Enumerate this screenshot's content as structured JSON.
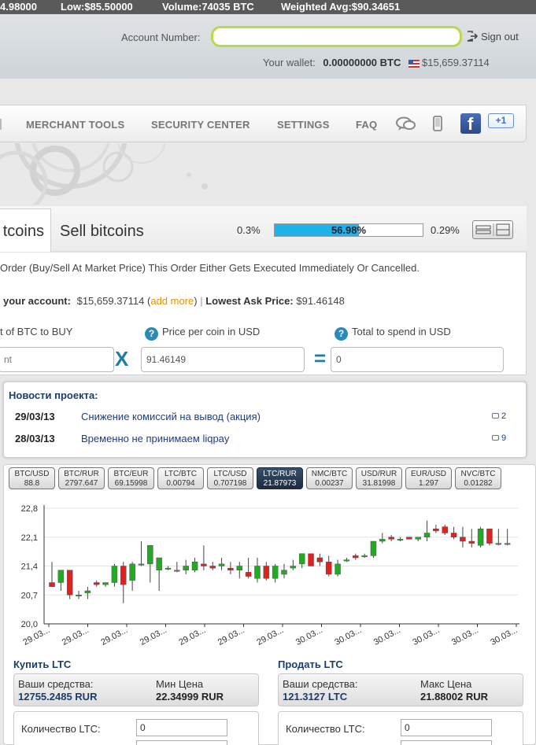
{
  "ticker": {
    "last": "4.98000",
    "low": "Low:$85.50000",
    "volume": "Volume:74035 BTC",
    "weighted": "Weighted Avg:$90.34651"
  },
  "header": {
    "account_label": "Account Number:",
    "account_value": "",
    "sign_out": "Sign out",
    "wallet_label": "Your wallet:",
    "wallet_btc": "0.00000000 BTC",
    "wallet_usd": "$15,659.37114"
  },
  "nav": {
    "items": [
      {
        "label": "MERCHANT TOOLS"
      },
      {
        "label": "SECURITY CENTER"
      },
      {
        "label": "SETTINGS"
      },
      {
        "label": "FAQ"
      }
    ],
    "gplus_label": "+1"
  },
  "trade": {
    "tab_buy": "tcoins",
    "tab_sell": "Sell bitcoins",
    "fee_left": "0.3%",
    "fee_right": "0.29%",
    "progress_text": "56.98%",
    "progress_value": 0.5698,
    "order_desc": "Order (Buy/Sell At Market Price) This Order Either Gets Executed Immediately Or Cancelled.",
    "acct_label": "your account:",
    "acct_value": "$15,659.37114",
    "add_more": "add more",
    "lowest_ask_label": "Lowest Ask Price:",
    "lowest_ask_value": "$91.46148",
    "label_amount": "t of BTC to BUY",
    "label_price": "Price per coin in USD",
    "label_total": "Total to spend in USD",
    "amount_placeholder": "nt",
    "price_value": "91.46149",
    "total_value": "0",
    "op_times": "X",
    "op_equals": "="
  },
  "news": {
    "title": "Новости проекта:",
    "items": [
      {
        "date": "29/03/13",
        "text": "Снижение комиссий на вывод (акция)",
        "count": "2"
      },
      {
        "date": "28/03/13",
        "text": "Временно не принимаем liqpay",
        "count": "9"
      }
    ]
  },
  "pairs": [
    {
      "name": "BTC/USD",
      "price": "88.8"
    },
    {
      "name": "BTC/RUR",
      "price": "2797.647"
    },
    {
      "name": "BTC/EUR",
      "price": "69.15998"
    },
    {
      "name": "LTC/BTC",
      "price": "0.00794"
    },
    {
      "name": "LTC/USD",
      "price": "0.707198"
    },
    {
      "name": "LTC/RUR",
      "price": "21.87973",
      "active": true
    },
    {
      "name": "NMC/BTC",
      "price": "0.00237"
    },
    {
      "name": "USD/RUR",
      "price": "31.81998"
    },
    {
      "name": "EUR/USD",
      "price": "1.297"
    },
    {
      "name": "NVC/BTC",
      "price": "0.01282"
    }
  ],
  "chart_data": {
    "type": "candlestick",
    "yticks": [
      "22,8",
      "22,1",
      "21,4",
      "20,7",
      "20,0"
    ],
    "ylim": [
      20.0,
      22.8
    ],
    "xticks": [
      "29.03...",
      "29.03...",
      "29.03...",
      "29.03...",
      "29.03...",
      "29.03...",
      "29.03...",
      "30.03...",
      "30.03...",
      "30.03...",
      "30.03...",
      "30.03...",
      "30.03..."
    ],
    "colors": {
      "up": "#22aa22",
      "down": "#dd2222"
    },
    "candles": [
      {
        "o": 21.0,
        "h": 21.5,
        "l": 20.9,
        "c": 20.9
      },
      {
        "o": 21.0,
        "h": 21.3,
        "l": 20.8,
        "c": 21.3
      },
      {
        "o": 21.3,
        "h": 21.3,
        "l": 20.6,
        "c": 20.7
      },
      {
        "o": 20.7,
        "h": 20.8,
        "l": 20.6,
        "c": 20.7
      },
      {
        "o": 20.75,
        "h": 20.9,
        "l": 20.6,
        "c": 20.8
      },
      {
        "o": 21.0,
        "h": 21.05,
        "l": 20.9,
        "c": 20.95
      },
      {
        "o": 20.95,
        "h": 21.0,
        "l": 20.9,
        "c": 21.0
      },
      {
        "o": 21.0,
        "h": 21.45,
        "l": 20.9,
        "c": 21.4
      },
      {
        "o": 21.4,
        "h": 21.5,
        "l": 20.5,
        "c": 20.95
      },
      {
        "o": 21.05,
        "h": 21.5,
        "l": 20.8,
        "c": 21.45
      },
      {
        "o": 21.45,
        "h": 22.0,
        "l": 21.4,
        "c": 21.45
      },
      {
        "o": 21.45,
        "h": 21.9,
        "l": 21.0,
        "c": 21.9
      },
      {
        "o": 21.3,
        "h": 21.6,
        "l": 20.8,
        "c": 21.6
      },
      {
        "o": 21.35,
        "h": 21.4,
        "l": 21.3,
        "c": 21.35
      },
      {
        "o": 21.3,
        "h": 21.5,
        "l": 21.25,
        "c": 21.3
      },
      {
        "o": 21.3,
        "h": 21.55,
        "l": 21.2,
        "c": 21.4
      },
      {
        "o": 21.3,
        "h": 21.6,
        "l": 21.25,
        "c": 21.5
      },
      {
        "o": 21.45,
        "h": 21.9,
        "l": 21.3,
        "c": 21.4
      },
      {
        "o": 21.4,
        "h": 21.5,
        "l": 21.3,
        "c": 21.35
      },
      {
        "o": 21.4,
        "h": 21.6,
        "l": 21.3,
        "c": 21.45
      },
      {
        "o": 21.35,
        "h": 21.5,
        "l": 21.2,
        "c": 21.3
      },
      {
        "o": 21.3,
        "h": 21.5,
        "l": 21.1,
        "c": 21.4
      },
      {
        "o": 21.25,
        "h": 21.6,
        "l": 21.1,
        "c": 21.15
      },
      {
        "o": 21.1,
        "h": 21.6,
        "l": 21.0,
        "c": 21.4
      },
      {
        "o": 21.4,
        "h": 21.5,
        "l": 21.05,
        "c": 21.1
      },
      {
        "o": 21.1,
        "h": 21.45,
        "l": 21.0,
        "c": 21.4
      },
      {
        "o": 21.2,
        "h": 21.45,
        "l": 21.1,
        "c": 21.3
      },
      {
        "o": 21.35,
        "h": 21.55,
        "l": 21.3,
        "c": 21.4
      },
      {
        "o": 21.45,
        "h": 21.55,
        "l": 21.35,
        "c": 21.7
      },
      {
        "o": 21.7,
        "h": 21.7,
        "l": 21.4,
        "c": 21.4
      },
      {
        "o": 21.6,
        "h": 21.7,
        "l": 21.4,
        "c": 21.5
      },
      {
        "o": 21.5,
        "h": 21.65,
        "l": 21.15,
        "c": 21.2
      },
      {
        "o": 21.2,
        "h": 21.55,
        "l": 21.15,
        "c": 21.45
      },
      {
        "o": 21.55,
        "h": 21.6,
        "l": 21.5,
        "c": 21.55
      },
      {
        "o": 21.65,
        "h": 21.7,
        "l": 21.55,
        "c": 21.6
      },
      {
        "o": 21.65,
        "h": 21.7,
        "l": 21.6,
        "c": 21.65
      },
      {
        "o": 21.65,
        "h": 22.0,
        "l": 21.6,
        "c": 22.0
      },
      {
        "o": 22.0,
        "h": 22.2,
        "l": 21.95,
        "c": 22.05
      },
      {
        "o": 22.1,
        "h": 22.15,
        "l": 22.0,
        "c": 22.05
      },
      {
        "o": 22.05,
        "h": 22.1,
        "l": 22.0,
        "c": 22.05
      },
      {
        "o": 22.1,
        "h": 22.1,
        "l": 22.05,
        "c": 22.05
      },
      {
        "o": 22.05,
        "h": 22.1,
        "l": 22.0,
        "c": 22.1
      },
      {
        "o": 22.1,
        "h": 22.5,
        "l": 22.0,
        "c": 22.2
      },
      {
        "o": 22.3,
        "h": 22.4,
        "l": 22.2,
        "c": 22.25
      },
      {
        "o": 22.35,
        "h": 22.4,
        "l": 22.15,
        "c": 22.2
      },
      {
        "o": 22.2,
        "h": 22.35,
        "l": 22.05,
        "c": 22.1
      },
      {
        "o": 22.1,
        "h": 22.35,
        "l": 21.85,
        "c": 22.0
      },
      {
        "o": 22.0,
        "h": 22.3,
        "l": 21.85,
        "c": 21.95
      },
      {
        "o": 21.9,
        "h": 22.35,
        "l": 21.85,
        "c": 22.3
      },
      {
        "o": 22.3,
        "h": 22.3,
        "l": 21.9,
        "c": 21.95
      },
      {
        "o": 21.95,
        "h": 22.3,
        "l": 21.9,
        "c": 21.95
      },
      {
        "o": 21.95,
        "h": 22.3,
        "l": 21.9,
        "c": 21.95
      }
    ]
  },
  "buy_box": {
    "title": "Купить LTC",
    "funds_label": "Ваши средства:",
    "funds_value": "12755.2485 RUR",
    "price_label": "Мин Цена",
    "price_value": "22.34999 RUR",
    "qty_label": "Количество LTC:",
    "qty_value": "0"
  },
  "sell_box": {
    "title": "Продать LTC",
    "funds_label": "Ваши средства:",
    "funds_value": "121.3127 LTC",
    "price_label": "Макс Цена",
    "price_value": "21.88002 RUR",
    "qty_label": "Количество LTC:",
    "qty_value": "0"
  }
}
